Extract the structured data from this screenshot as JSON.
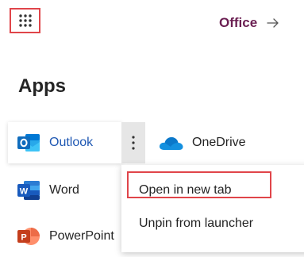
{
  "header": {
    "launcher_icon": "waffle-grid-icon",
    "office_link_label": "Office",
    "office_link_icon": "arrow-right-icon"
  },
  "apps": {
    "heading": "Apps",
    "items": [
      {
        "label": "Outlook",
        "icon": "outlook-icon",
        "state": "hovered"
      },
      {
        "label": "OneDrive",
        "icon": "onedrive-icon"
      },
      {
        "label": "Word",
        "icon": "word-icon"
      },
      {
        "label": "PowerPoint",
        "icon": "powerpoint-icon"
      }
    ],
    "more_options_icon": "more-vertical-icon"
  },
  "context_menu": {
    "items": [
      {
        "label": "Open in new tab",
        "highlighted": true
      },
      {
        "label": "Unpin from launcher"
      }
    ]
  },
  "colors": {
    "highlight_border": "#e0454a",
    "office_link": "#6b1f52",
    "outlook_label": "#1f58b3",
    "more_button_bg": "#e6e6e6"
  }
}
